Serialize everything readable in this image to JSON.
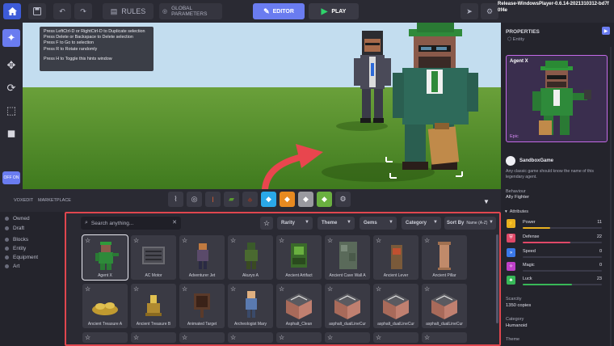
{
  "topbar": {
    "rules_label": "RULES",
    "global_params_label": "GLOBAL PARAMETERS",
    "editor_label": "EDITOR",
    "play_label": "PLAY",
    "version": "Release-WindowsPlayer-0.6.14-2021310312-bd7f0f4e"
  },
  "rail": {
    "toggle_label": "OFF ON"
  },
  "hints": [
    "Press LeftCtrl-D or RightCtrl-D to Duplicate selection",
    "Press Delete or Backspace to Delete selection",
    "Press F to Go to selection",
    "Press R to Rotate randomly",
    "",
    "Press H to Toggle this hints window"
  ],
  "subtabs": {
    "voxedit": "VOXEDIT",
    "marketplace": "MARKETPLACE"
  },
  "categories": [
    "Owned",
    "Draft",
    "Blocks",
    "Entity",
    "Equipment",
    "Art"
  ],
  "browser": {
    "search_placeholder": "Search anything...",
    "filters": {
      "rarity": "Rarity",
      "theme": "Theme",
      "gems": "Gems",
      "category": "Category",
      "sort_by": "Sort By",
      "sort_value": "Name (A-Z)"
    },
    "assets": [
      {
        "name": "Agent X",
        "kind": "agent"
      },
      {
        "name": "AC Motor",
        "kind": "motor"
      },
      {
        "name": "Adventurer Jet",
        "kind": "jet"
      },
      {
        "name": "Akuryo A",
        "kind": "akuryo"
      },
      {
        "name": "Ancient Artifact",
        "kind": "artifact"
      },
      {
        "name": "Ancient Cave Wall A",
        "kind": "cavewall"
      },
      {
        "name": "Ancient Lever",
        "kind": "lever"
      },
      {
        "name": "Ancient Pillar",
        "kind": "pillar"
      },
      {
        "name": "Ancient Treasure A",
        "kind": "treasure"
      },
      {
        "name": "Ancient Treasure B",
        "kind": "treasureb"
      },
      {
        "name": "Animated Target",
        "kind": "target"
      },
      {
        "name": "Archeologist Mary",
        "kind": "mary"
      },
      {
        "name": "Asphalt_Clean",
        "kind": "block"
      },
      {
        "name": "asphalt_dualLineCur",
        "kind": "block"
      },
      {
        "name": "asphalt_dualLineCur",
        "kind": "block"
      },
      {
        "name": "asphalt_dualLineCur",
        "kind": "block"
      }
    ]
  },
  "properties": {
    "title": "PROPERTIES",
    "type": "Entity",
    "card_name": "Agent X",
    "rarity": "Epic",
    "creator": "SandboxGame",
    "description": "Any classic game should know the name of this legendary agent.",
    "behaviour_label": "Behaviour",
    "behaviour_value": "Ally Fighter",
    "attributes_label": "Attributes",
    "attributes": [
      {
        "name": "Power",
        "value": "11",
        "color": "#e8b020",
        "fraction": 0.35
      },
      {
        "name": "Defense",
        "value": "22",
        "color": "#e04868",
        "fraction": 0.6
      },
      {
        "name": "Speed",
        "value": "0",
        "color": "#3a78e8",
        "fraction": 0
      },
      {
        "name": "Magic",
        "value": "0",
        "color": "#c040c8",
        "fraction": 0
      },
      {
        "name": "Luck",
        "value": "23",
        "color": "#38b858",
        "fraction": 0.62
      }
    ],
    "scarcity_label": "Scarcity",
    "scarcity_value": "1350 copies",
    "category_label": "Category",
    "category_value": "Humanoid",
    "theme_label": "Theme"
  },
  "colors": {
    "accent": "#6a7cf0",
    "highlight_border": "#e0464e",
    "play_green": "#2fd36b",
    "epic": "#c46ae8"
  }
}
